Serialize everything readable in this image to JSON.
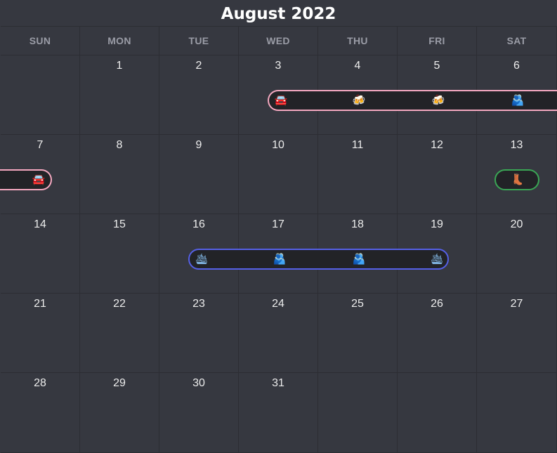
{
  "header": {
    "title": "August 2022"
  },
  "weekdays": [
    "SUN",
    "MON",
    "TUE",
    "WED",
    "THU",
    "FRI",
    "SAT"
  ],
  "weeks": [
    [
      "",
      "1",
      "2",
      "3",
      "4",
      "5",
      "6"
    ],
    [
      "7",
      "8",
      "9",
      "10",
      "11",
      "12",
      "13"
    ],
    [
      "14",
      "15",
      "16",
      "17",
      "18",
      "19",
      "20"
    ],
    [
      "21",
      "22",
      "23",
      "24",
      "25",
      "26",
      "27"
    ],
    [
      "28",
      "29",
      "30",
      "31",
      "",
      "",
      ""
    ]
  ],
  "events": [
    {
      "id": "trip-1-week-1",
      "color": "#f4a8c0",
      "icons": [
        "🚘",
        "🍻",
        "🍻",
        "🫂"
      ],
      "icon_names": [
        "car-icon",
        "beer-icon",
        "beer-icon",
        "hug-icon"
      ]
    },
    {
      "id": "trip-1-week-2",
      "color": "#f4a8c0",
      "icons": [
        "🚘"
      ],
      "icon_names": [
        "car-icon"
      ]
    },
    {
      "id": "hike",
      "color": "#3aa655",
      "icons": [
        "👢"
      ],
      "icon_names": [
        "boot-icon"
      ]
    },
    {
      "id": "cruise",
      "color": "#5560e6",
      "icons": [
        "🛳",
        "🫂",
        "🫂",
        "🛳"
      ],
      "icon_names": [
        "ship-icon",
        "hug-icon",
        "hug-icon",
        "ship-icon"
      ]
    }
  ]
}
